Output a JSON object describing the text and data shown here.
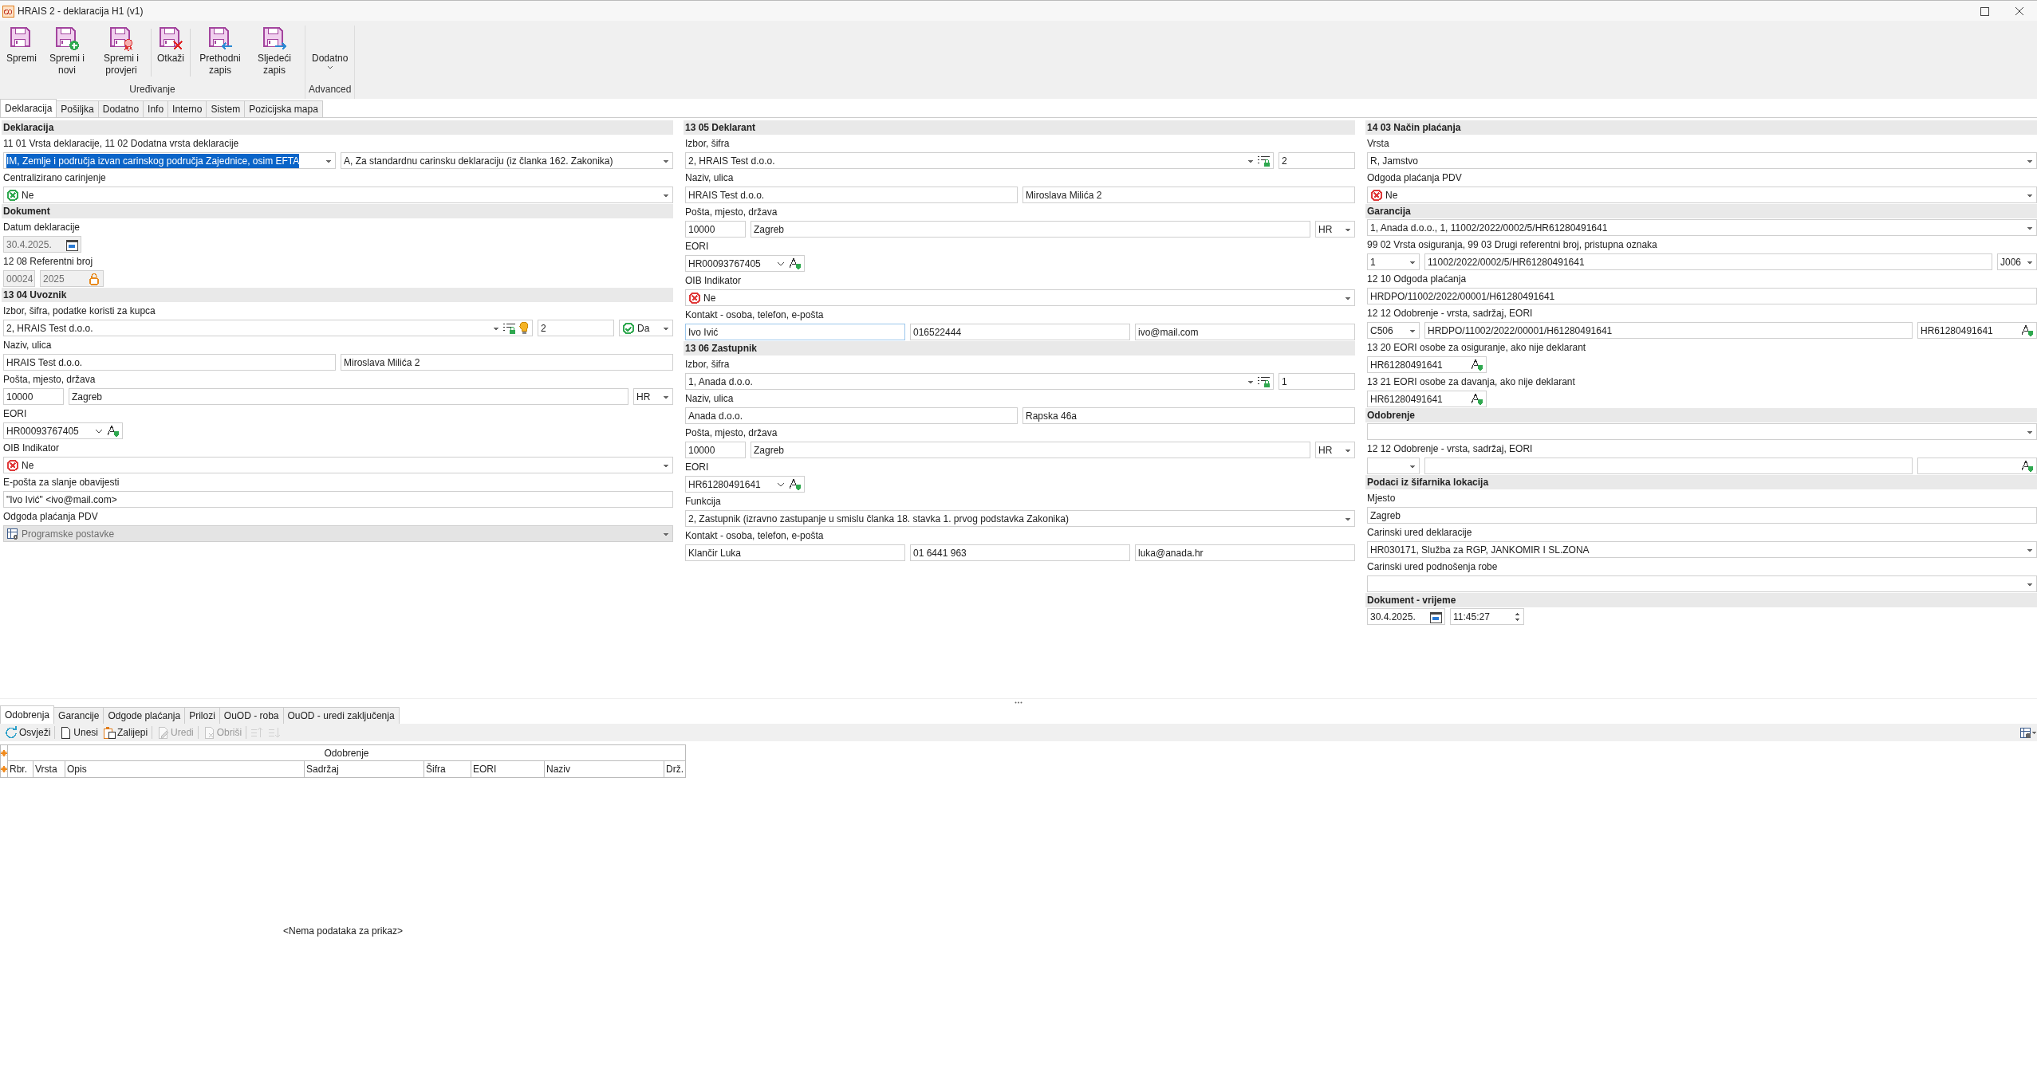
{
  "window": {
    "title": "HRAIS 2 - deklaracija H1 (v1)"
  },
  "ribbon": {
    "groups": [
      {
        "label": "Uređivanje",
        "clusters": [
          [
            {
              "kind": "save",
              "label": "Spremi"
            },
            {
              "kind": "save-new",
              "label": "Spremi i novi"
            },
            {
              "kind": "save-check",
              "label": "Spremi i provjeri"
            }
          ],
          [
            {
              "kind": "cancel",
              "label": "Otkaži"
            }
          ],
          [
            {
              "kind": "previous",
              "label": "Prethodni zapis"
            },
            {
              "kind": "next",
              "label": "Sljedeći zapis"
            }
          ]
        ]
      },
      {
        "label": "Advanced",
        "clusters": [
          [
            {
              "kind": "dropdown",
              "label": "Dodatno"
            }
          ]
        ]
      }
    ]
  },
  "tabs": [
    {
      "label": "Deklaracija",
      "selected": true
    },
    {
      "label": "Pošiljka",
      "selected": false
    },
    {
      "label": "Dodatno",
      "selected": false
    },
    {
      "label": "Info",
      "selected": false
    },
    {
      "label": "Interno",
      "selected": false
    },
    {
      "label": "Sistem",
      "selected": false
    },
    {
      "label": "Pozicijska mapa",
      "selected": false
    }
  ],
  "columns": [
    {
      "sections": [
        {
          "title": "Deklaracija",
          "rows": [
            {
              "kind": "label",
              "text": "11 01 Vrsta deklaracije, 11 02 Dodatna vrsta deklaracije"
            },
            {
              "kind": "fields",
              "fields": [
                {
                  "kind": "combo",
                  "value": "IM, Zemlje i područja izvan carinskog područja Zajednice, osim EFTA",
                  "selected": true
                },
                {
                  "kind": "combo",
                  "value": "A, Za standardnu carinsku deklaraciju (iz članka 162. Zakonika)",
                  "selected": false
                }
              ]
            },
            {
              "kind": "label",
              "text": "Centralizirano carinjenje"
            },
            {
              "kind": "fields",
              "fields": [
                {
                  "kind": "status-no",
                  "color": "#2fa84f",
                  "value": "Ne"
                }
              ]
            }
          ]
        },
        {
          "title": "Dokument",
          "rows": [
            {
              "kind": "label",
              "text": "Datum deklaracije"
            },
            {
              "kind": "fields",
              "fields": [
                {
                  "kind": "date",
                  "value": "30.4.2025.",
                  "disabled": true
                }
              ]
            },
            {
              "kind": "label",
              "text": "12 08 Referentni broj"
            },
            {
              "kind": "fields",
              "fields": [
                {
                  "kind": "tiny",
                  "value": "00024",
                  "disabled": true
                },
                {
                  "kind": "locked",
                  "value": "2025",
                  "disabled": true
                }
              ]
            }
          ]
        },
        {
          "title": "13 04 Uvoznik",
          "rows": [
            {
              "kind": "label",
              "text": "Izbor, šifra, podatke koristi za kupca"
            },
            {
              "kind": "fields",
              "fields": [
                {
                  "kind": "partner",
                  "value": "2, HRAIS Test d.o.o.",
                  "bulb": true
                },
                {
                  "kind": "code",
                  "value": "2"
                },
                {
                  "kind": "status-yes-short",
                  "color": "#2fa84f",
                  "value": "Da"
                }
              ]
            },
            {
              "kind": "label",
              "text": "Naziv, ulica"
            },
            {
              "kind": "fields",
              "fields": [
                {
                  "kind": "text",
                  "value": "HRAIS Test d.o.o."
                },
                {
                  "kind": "text",
                  "value": "Miroslava Milića 2"
                }
              ]
            },
            {
              "kind": "label",
              "text": "Pošta, mjesto, država"
            },
            {
              "kind": "fields",
              "fields": [
                {
                  "kind": "short",
                  "value": "10000"
                },
                {
                  "kind": "text",
                  "value": "Zagreb"
                },
                {
                  "kind": "smallcombo",
                  "value": "HR"
                }
              ]
            },
            {
              "kind": "label",
              "text": "EORI"
            },
            {
              "kind": "fields",
              "fields": [
                {
                  "kind": "eori",
                  "value": "HR00093767405",
                  "dropdown": true
                }
              ]
            },
            {
              "kind": "label",
              "text": "OIB Indikator"
            },
            {
              "kind": "fields",
              "fields": [
                {
                  "kind": "status-no",
                  "color": "#e03a3a",
                  "value": "Ne"
                }
              ]
            },
            {
              "kind": "label",
              "text": "E-pošta za slanje obavijesti"
            },
            {
              "kind": "fields",
              "fields": [
                {
                  "kind": "text",
                  "value": "\"Ivo Ivić\" <ivo@mail.com>"
                }
              ]
            },
            {
              "kind": "label",
              "text": "Odgoda plaćanja PDV"
            },
            {
              "kind": "fields",
              "fields": [
                {
                  "kind": "status-default",
                  "value": "Programske postavke",
                  "disabled": true
                }
              ]
            }
          ]
        }
      ]
    },
    {
      "sections": [
        {
          "title": "13 05 Deklarant",
          "rows": [
            {
              "kind": "label",
              "text": "Izbor, šifra"
            },
            {
              "kind": "fields",
              "fields": [
                {
                  "kind": "partner",
                  "value": "2, HRAIS Test d.o.o.",
                  "bulb": false
                },
                {
                  "kind": "code",
                  "value": "2"
                }
              ]
            },
            {
              "kind": "label",
              "text": "Naziv, ulica"
            },
            {
              "kind": "fields",
              "fields": [
                {
                  "kind": "text",
                  "value": "HRAIS Test d.o.o."
                },
                {
                  "kind": "text",
                  "value": "Miroslava Milića 2"
                }
              ]
            },
            {
              "kind": "label",
              "text": "Pošta, mjesto, država"
            },
            {
              "kind": "fields",
              "fields": [
                {
                  "kind": "short",
                  "value": "10000"
                },
                {
                  "kind": "text",
                  "value": "Zagreb"
                },
                {
                  "kind": "smallcombo",
                  "value": "HR"
                }
              ]
            },
            {
              "kind": "label",
              "text": "EORI"
            },
            {
              "kind": "fields",
              "fields": [
                {
                  "kind": "eori",
                  "value": "HR00093767405",
                  "dropdown": true
                }
              ]
            },
            {
              "kind": "label",
              "text": "OIB Indikator"
            },
            {
              "kind": "fields",
              "fields": [
                {
                  "kind": "status-no",
                  "color": "#e03a3a",
                  "value": "Ne"
                }
              ]
            },
            {
              "kind": "label",
              "text": "Kontakt - osoba, telefon, e-pošta"
            },
            {
              "kind": "fields",
              "fields": [
                {
                  "kind": "text",
                  "value": "Ivo Ivić",
                  "focused": true
                },
                {
                  "kind": "text",
                  "value": "016522444",
                  "focused": false
                },
                {
                  "kind": "text",
                  "value": "ivo@mail.com",
                  "focused": false
                }
              ]
            }
          ]
        },
        {
          "title": "13 06 Zastupnik",
          "rows": [
            {
              "kind": "label",
              "text": "Izbor, šifra"
            },
            {
              "kind": "fields",
              "fields": [
                {
                  "kind": "partner",
                  "value": "1, Anada d.o.o.",
                  "bulb": false
                },
                {
                  "kind": "code",
                  "value": "1"
                }
              ]
            },
            {
              "kind": "label",
              "text": "Naziv, ulica"
            },
            {
              "kind": "fields",
              "fields": [
                {
                  "kind": "text",
                  "value": "Anada d.o.o."
                },
                {
                  "kind": "text",
                  "value": "Rapska 46a"
                }
              ]
            },
            {
              "kind": "label",
              "text": "Pošta, mjesto, država"
            },
            {
              "kind": "fields",
              "fields": [
                {
                  "kind": "short",
                  "value": "10000"
                },
                {
                  "kind": "text",
                  "value": "Zagreb"
                },
                {
                  "kind": "smallcombo",
                  "value": "HR"
                }
              ]
            },
            {
              "kind": "label",
              "text": "EORI"
            },
            {
              "kind": "fields",
              "fields": [
                {
                  "kind": "eori",
                  "value": "HR61280491641",
                  "dropdown": true
                }
              ]
            },
            {
              "kind": "label",
              "text": "Funkcija"
            },
            {
              "kind": "fields",
              "fields": [
                {
                  "kind": "combo",
                  "value": "2, Zastupnik (izravno zastupanje u smislu članka 18. stavka 1. prvog podstavka Zakonika)"
                }
              ]
            },
            {
              "kind": "label",
              "text": "Kontakt - osoba, telefon, e-pošta"
            },
            {
              "kind": "fields",
              "fields": [
                {
                  "kind": "text",
                  "value": "Klančir Luka"
                },
                {
                  "kind": "text",
                  "value": "01 6441 963"
                },
                {
                  "kind": "text",
                  "value": "luka@anada.hr"
                }
              ]
            }
          ]
        }
      ]
    },
    {
      "sections": [
        {
          "title": "14 03 Način plaćanja",
          "rows": [
            {
              "kind": "label",
              "text": "Vrsta"
            },
            {
              "kind": "fields",
              "fields": [
                {
                  "kind": "combo",
                  "value": "R, Jamstvo"
                }
              ]
            },
            {
              "kind": "label",
              "text": "Odgoda plaćanja PDV"
            },
            {
              "kind": "fields",
              "fields": [
                {
                  "kind": "status-no",
                  "color": "#e03a3a",
                  "value": "Ne"
                }
              ]
            }
          ]
        },
        {
          "title": "Garancija",
          "rows": [
            {
              "kind": "fields",
              "fields": [
                {
                  "kind": "combo",
                  "value": "1, Anada d.o.o., 1, 11002/2022/0002/5/HR61280491641"
                }
              ]
            },
            {
              "kind": "label",
              "text": "99 02 Vrsta osiguranja, 99 03 Drugi referentni broj, pristupna oznaka"
            },
            {
              "kind": "fields",
              "fields": [
                {
                  "kind": "smallcombo",
                  "value": "1"
                },
                {
                  "kind": "text",
                  "value": "11002/2022/0002/5/HR61280491641"
                },
                {
                  "kind": "smallcombo",
                  "value": "J006"
                }
              ]
            },
            {
              "kind": "label",
              "text": "12 10 Odgoda plaćanja"
            },
            {
              "kind": "fields",
              "fields": [
                {
                  "kind": "text",
                  "value": "HRDPO/11002/2022/00001/H61280491641"
                }
              ]
            },
            {
              "kind": "label",
              "text": "12 12 Odobrenje - vrsta, sadržaj, EORI"
            },
            {
              "kind": "fields",
              "fields": [
                {
                  "kind": "smallcombo",
                  "value": "C506"
                },
                {
                  "kind": "text",
                  "value": "HRDPO/11002/2022/00001/H61280491641"
                },
                {
                  "kind": "eori",
                  "value": "HR61280491641",
                  "dropdown": false
                }
              ]
            },
            {
              "kind": "label",
              "text": "13 20 EORI osobe za osiguranje, ako nije deklarant"
            },
            {
              "kind": "fields",
              "fields": [
                {
                  "kind": "eori",
                  "value": "HR61280491641",
                  "dropdown": false
                }
              ]
            },
            {
              "kind": "label",
              "text": "13 21 EORI osobe za davanja, ako nije deklarant"
            },
            {
              "kind": "fields",
              "fields": [
                {
                  "kind": "eori",
                  "value": "HR61280491641",
                  "dropdown": false
                }
              ]
            }
          ]
        },
        {
          "title": "Odobrenje",
          "rows": [
            {
              "kind": "fields",
              "fields": [
                {
                  "kind": "combo"
                }
              ]
            },
            {
              "kind": "label",
              "text": "12 12 Odobrenje - vrsta, sadržaj, EORI"
            },
            {
              "kind": "fields",
              "fields": [
                {
                  "kind": "smallcombo"
                },
                {
                  "kind": "text"
                },
                {
                  "kind": "eori",
                  "dropdown": false
                }
              ]
            }
          ]
        },
        {
          "title": "Podaci iz šifarnika lokacija",
          "rows": [
            {
              "kind": "label",
              "text": "Mjesto"
            },
            {
              "kind": "fields",
              "fields": [
                {
                  "kind": "text",
                  "value": "Zagreb"
                }
              ]
            },
            {
              "kind": "label",
              "text": "Carinski ured deklaracije"
            },
            {
              "kind": "fields",
              "fields": [
                {
                  "kind": "combo",
                  "value": "HR030171, Služba za RGP, JANKOMIR I SL.ZONA"
                }
              ]
            },
            {
              "kind": "label",
              "text": "Carinski ured podnošenja robe"
            },
            {
              "kind": "fields",
              "fields": [
                {
                  "kind": "combo"
                }
              ]
            }
          ]
        },
        {
          "title": "Dokument - vrijeme",
          "rows": [
            {
              "kind": "fields",
              "fields": [
                {
                  "kind": "date",
                  "value": "30.4.2025."
                },
                {
                  "kind": "time",
                  "value": "11:45:27"
                }
              ]
            }
          ]
        }
      ]
    }
  ],
  "bottom_tabs": [
    {
      "label": "Odobrenja",
      "selected": true
    },
    {
      "label": "Garancije",
      "selected": false
    },
    {
      "label": "Odgode plaćanja",
      "selected": false
    },
    {
      "label": "Prilozi",
      "selected": false
    },
    {
      "label": "OuOD - roba",
      "selected": false
    },
    {
      "label": "OuOD - uredi zaključenja",
      "selected": false
    }
  ],
  "toolbar": [
    [
      {
        "kind": "refresh",
        "label": "Osvježi",
        "disabled": false
      }
    ],
    [
      {
        "kind": "new",
        "label": "Unesi",
        "disabled": false
      },
      {
        "kind": "paste",
        "label": "Zalijepi",
        "disabled": false
      }
    ],
    [
      {
        "kind": "edit",
        "label": "Uredi",
        "disabled": true
      }
    ],
    [
      {
        "kind": "delete",
        "label": "Obriši",
        "disabled": true
      }
    ],
    [
      {
        "kind": "sort-up",
        "disabled": true
      },
      {
        "kind": "sort-down",
        "disabled": true
      }
    ]
  ],
  "grid": {
    "band": "Odobrenje",
    "columns": [
      "Rbr.",
      "Vrsta",
      "Opis",
      "Sadržaj",
      "Šifra",
      "EORI",
      "Naziv",
      "Drž."
    ],
    "empty_text": "<Nema podataka za prikaz>"
  }
}
